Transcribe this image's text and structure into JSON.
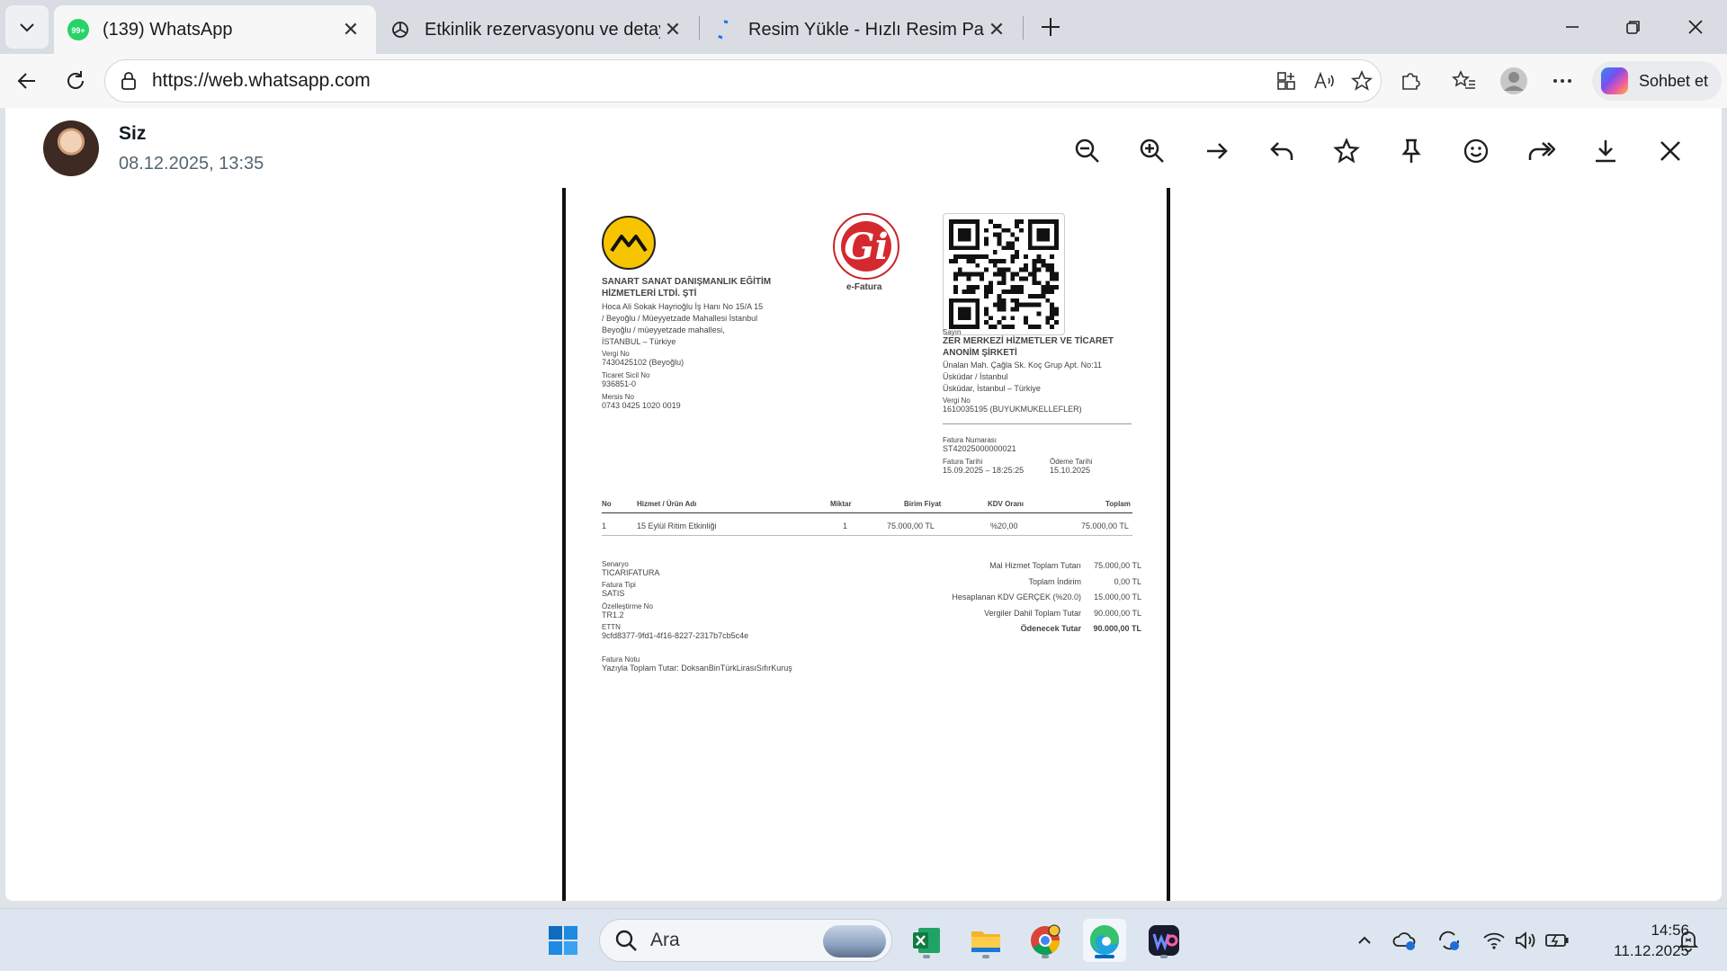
{
  "browser": {
    "tabs": [
      {
        "title": "(139) WhatsApp",
        "badge": "99+",
        "active": true
      },
      {
        "title": "Etkinlik rezervasyonu ve detaylar",
        "active": false
      },
      {
        "title": "Resim Yükle - Hızlı Resim Paylaş - ",
        "active": false
      }
    ],
    "url": "https://web.whatsapp.com",
    "copilot_label": "Sohbet et"
  },
  "viewer": {
    "sender_name": "Siz",
    "sent_at": "08.12.2025, 13:35",
    "actions": [
      "zoom-out",
      "zoom-in",
      "next",
      "reply",
      "star",
      "pin",
      "react",
      "forward",
      "download",
      "close"
    ]
  },
  "invoice": {
    "seller_name_1": "SANART SANAT DANIŞMANLIK EĞİTİM",
    "seller_name_2": "HİZMETLERİ LTDİ. ŞTİ",
    "seller_addr_1": "Hoca Ali Sokak Hayrioğlu İş Hanı No 15/A 15",
    "seller_addr_2": "/ Beyoğlu / Müeyyetzade Mahallesi İstanbul",
    "seller_addr_3": "Beyoğlu / müeyyetzade mahallesi,",
    "seller_addr_4": "İSTANBUL – Türkiye",
    "tax_no_label": "Vergi No",
    "tax_no": "7430425102 (Beyoğlu)",
    "trade_reg_label": "Ticaret Sicil No",
    "trade_reg": "936851-0",
    "mersis_label": "Mersis No",
    "mersis": "0743 0425 1020 0019",
    "efatura_label": "e-Fatura",
    "buyer_label": "Sayın",
    "buyer_name_1": "ZER MERKEZİ HİZMETLER VE TİCARET",
    "buyer_name_2": "ANONİM ŞİRKETİ",
    "buyer_addr_1": "Ünalan Mah. Çağla Sk. Koç Grup Apt. No:11",
    "buyer_addr_2": "Üsküdar / İstanbul",
    "buyer_addr_3": "Üsküdar, İstanbul – Türkiye",
    "buyer_tax_label": "Vergi No",
    "buyer_tax": "1610035195 (BUYUKMUKELLEFLER)",
    "invoice_no_label": "Fatura Numarası",
    "invoice_no": "ST42025000000021",
    "invoice_date_label": "Fatura Tarihi",
    "invoice_date": "15.09.2025 – 18:25:25",
    "due_date_label": "Ödeme Tarihi",
    "due_date": "15.10.2025",
    "table_headers": [
      "No",
      "Hizmet / Ürün Adı",
      "Miktar",
      "Birim Fiyat",
      "KDV Oranı",
      "Toplam"
    ],
    "table_rows": [
      [
        "1",
        "15 Eylül Ritim Etkinliği",
        "1",
        "75.000,00 TL",
        "%20,00",
        "75.000,00 TL"
      ]
    ],
    "scenario_label": "Senaryo",
    "scenario": "TICARIFATURA",
    "type_label": "Fatura Tipi",
    "type": "SATIS",
    "custom_label": "Özelleştirme No",
    "custom": "TR1.2",
    "ettn_label": "ETTN",
    "ettn": "9cfd8377-9fd1-4f16-8227-2317b7cb5c4e",
    "note_label": "Fatura Notu",
    "note": "Yazıyla Toplam Tutar: DoksanBinTürkLirasıSıfırKuruş",
    "totals": [
      {
        "label": "Mal Hizmet Toplam Tutarı",
        "value": "75.000,00 TL"
      },
      {
        "label": "Toplam İndirim",
        "value": "0,00 TL"
      },
      {
        "label": "Hesaplanan KDV GERÇEK (%20.0)",
        "value": "15.000,00 TL"
      },
      {
        "label": "Vergiler Dahil Toplam Tutar",
        "value": "90.000,00 TL"
      },
      {
        "label": "Ödenecek Tutar",
        "value": "90.000,00 TL"
      }
    ]
  },
  "taskbar": {
    "search_placeholder": "Ara",
    "time": "14:56",
    "date": "11.12.2025"
  }
}
